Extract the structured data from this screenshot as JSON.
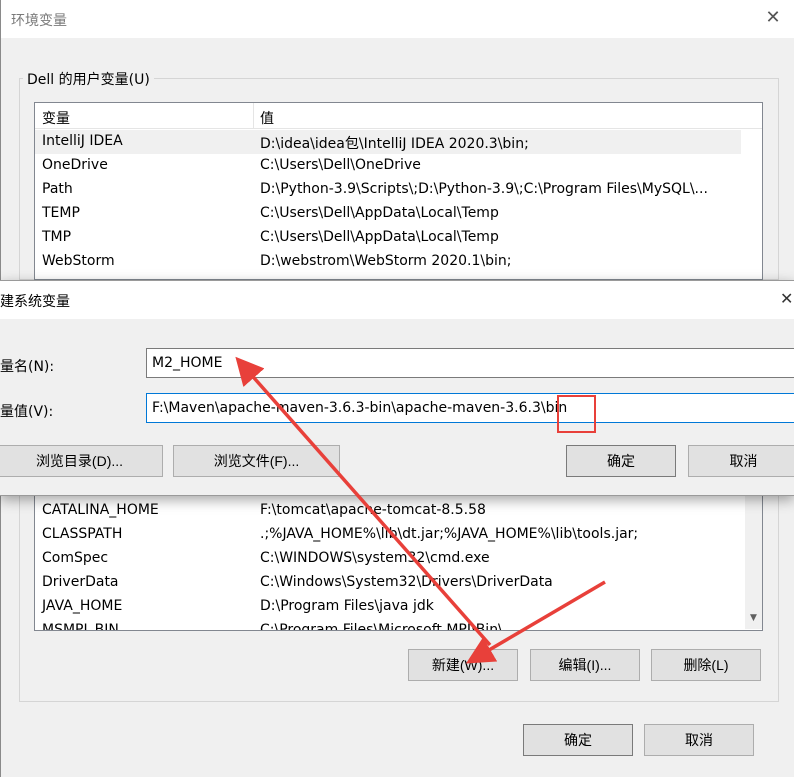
{
  "env_window": {
    "title": "环境变量",
    "user_group_label": "Dell 的用户变量(U)",
    "columns": [
      "变量",
      "值"
    ],
    "user_vars": [
      {
        "name": "IntelliJ IDEA",
        "value": "D:\\idea\\idea包\\IntelliJ IDEA 2020.3\\bin;"
      },
      {
        "name": "OneDrive",
        "value": "C:\\Users\\Dell\\OneDrive"
      },
      {
        "name": "Path",
        "value": "D:\\Python-3.9\\Scripts\\;D:\\Python-3.9\\;C:\\Program Files\\MySQL\\..."
      },
      {
        "name": "TEMP",
        "value": "C:\\Users\\Dell\\AppData\\Local\\Temp"
      },
      {
        "name": "TMP",
        "value": "C:\\Users\\Dell\\AppData\\Local\\Temp"
      },
      {
        "name": "WebStorm",
        "value": "D:\\webstrom\\WebStorm 2020.1\\bin;"
      }
    ],
    "system_vars": [
      {
        "name": "CATALINA_HOME",
        "value": "F:\\tomcat\\apache-tomcat-8.5.58"
      },
      {
        "name": "CLASSPATH",
        "value": ".;%JAVA_HOME%\\lib\\dt.jar;%JAVA_HOME%\\lib\\tools.jar;"
      },
      {
        "name": "ComSpec",
        "value": "C:\\WINDOWS\\system32\\cmd.exe"
      },
      {
        "name": "DriverData",
        "value": "C:\\Windows\\System32\\Drivers\\DriverData"
      },
      {
        "name": "JAVA_HOME",
        "value": "D:\\Program Files\\java jdk"
      },
      {
        "name": "MSMPI_BIN",
        "value": "C:\\Program Files\\Microsoft MPI\\Bin\\"
      }
    ],
    "buttons": {
      "new": "新建(W)...",
      "edit": "编辑(I)...",
      "delete": "删除(L)",
      "ok": "确定",
      "cancel": "取消"
    }
  },
  "new_dialog": {
    "title": "新建系统变量",
    "name_label": "变量名(N):",
    "value_label": "变量值(V):",
    "name_value": "M2_HOME",
    "value_value": "F:\\Maven\\apache-maven-3.6.3-bin\\apache-maven-3.6.3\\bin",
    "buttons": {
      "browse_dir": "浏览目录(D)...",
      "browse_file": "浏览文件(F)...",
      "ok": "确定",
      "cancel": "取消"
    }
  },
  "colors": {
    "annotation": "#e8403a",
    "focus_border": "#0078d7"
  }
}
